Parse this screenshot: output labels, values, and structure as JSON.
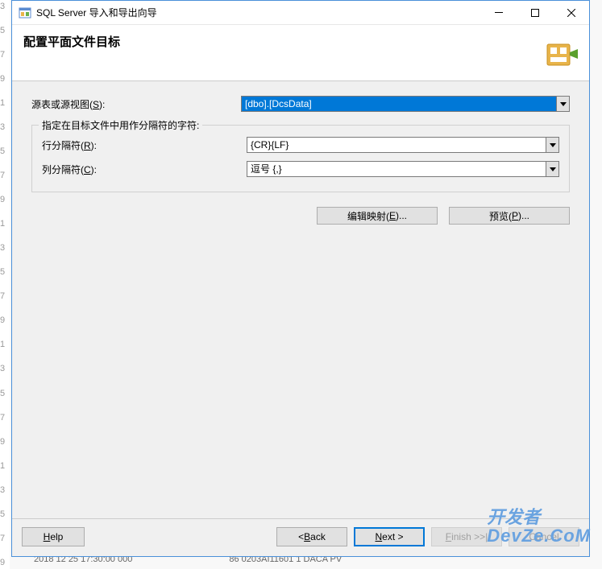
{
  "window": {
    "title": "SQL Server 导入和导出向导"
  },
  "header": {
    "title": "配置平面文件目标"
  },
  "source": {
    "label_pre": "源表或源视图(",
    "label_key": "S",
    "label_post": "):",
    "value": "[dbo].[DcsData]"
  },
  "delimiters": {
    "legend": "指定在目标文件中用作分隔符的字符:",
    "row": {
      "label_pre": "行分隔符(",
      "label_key": "R",
      "label_post": "):",
      "value": "{CR}{LF}"
    },
    "col": {
      "label_pre": "列分隔符(",
      "label_key": "C",
      "label_post": "):",
      "value": "逗号 {,}"
    }
  },
  "actions": {
    "edit_mappings_pre": "编辑映射(",
    "edit_mappings_key": "E",
    "edit_mappings_post": ")...",
    "preview_pre": "预览(",
    "preview_key": "P",
    "preview_post": ")..."
  },
  "footer": {
    "help_key": "H",
    "help_post": "elp",
    "back_pre": "< ",
    "back_key": "B",
    "back_post": "ack",
    "next_key": "N",
    "next_post": "ext >",
    "finish_key": "F",
    "finish_post": "inish >>|",
    "cancel": "Cancel"
  },
  "watermark": {
    "line1": "开发者",
    "line2": "DevZe.CoM"
  },
  "bg": {
    "bottom_left": "2018 12 25 17:30:00 000",
    "bottom_right": "86 0203AI11601 1 DACA PV"
  }
}
